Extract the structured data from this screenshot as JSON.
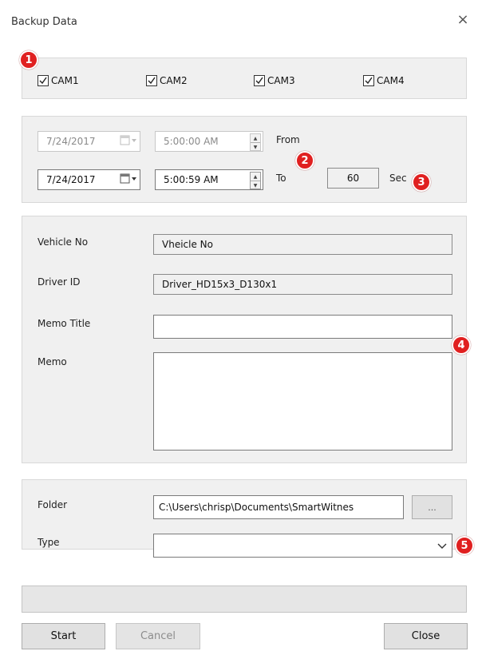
{
  "window": {
    "title": "Backup Data",
    "close_label": "×"
  },
  "cameras": [
    {
      "label": "CAM1",
      "checked": true
    },
    {
      "label": "CAM2",
      "checked": true
    },
    {
      "label": "CAM3",
      "checked": true
    },
    {
      "label": "CAM4",
      "checked": true
    }
  ],
  "time_range": {
    "from_date": "7/24/2017",
    "from_time": "5:00:00 AM",
    "from_label": "From",
    "to_date": "7/24/2017",
    "to_time": "5:00:59 AM",
    "to_label": "To",
    "duration": "60",
    "duration_unit": "Sec"
  },
  "info": {
    "vehicle_label": "Vehicle No",
    "vehicle_value": "Vheicle No",
    "driver_label": "Driver ID",
    "driver_value": "Driver_HD15x3_D130x1",
    "memo_title_label": "Memo Title",
    "memo_title_value": "",
    "memo_label": "Memo",
    "memo_value": ""
  },
  "output": {
    "folder_label": "Folder",
    "folder_value": "C:\\Users\\chrisp\\Documents\\SmartWitnes",
    "browse_label": "...",
    "type_label": "Type",
    "type_value": ""
  },
  "progress": {
    "value": 0
  },
  "buttons": {
    "start": "Start",
    "cancel": "Cancel",
    "close": "Close"
  },
  "badges": [
    "1",
    "2",
    "3",
    "4",
    "5"
  ],
  "colors": {
    "badge": "#e02020",
    "group_bg": "#f0f0f0"
  }
}
